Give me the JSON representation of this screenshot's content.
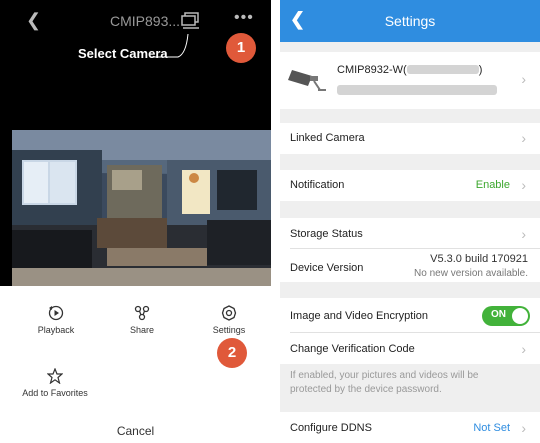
{
  "left": {
    "back_icon": "back-chevron-icon",
    "title": "CMIP893...",
    "more_icon": "more-dots-icon",
    "select_camera_label": "Select Camera",
    "annotation_1": "1",
    "annotation_2": "2",
    "actions": {
      "playback": "Playback",
      "share": "Share",
      "settings": "Settings",
      "favorites": "Add to Favorites"
    },
    "cancel": "Cancel"
  },
  "right": {
    "header": {
      "title": "Settings",
      "back_icon": "back-chevron-icon"
    },
    "device": {
      "name": "CMIP8932-W(",
      "name_suffix": ")"
    },
    "linked_camera": "Linked Camera",
    "notification": {
      "label": "Notification",
      "value": "Enable"
    },
    "storage_status": "Storage Status",
    "device_version": {
      "label": "Device Version",
      "value": "V5.3.0 build 170921",
      "status": "No new version available."
    },
    "encryption": {
      "label": "Image and Video Encryption",
      "toggle": "ON"
    },
    "change_code": "Change Verification Code",
    "encryption_note": "If enabled, your pictures and videos will be protected by the device password.",
    "ddns": {
      "label": "Configure DDNS",
      "value": "Not Set"
    }
  },
  "colors": {
    "accent": "#2f8de0",
    "enable_green": "#3ca72e",
    "toggle_green": "#42b23a",
    "badge": "#e0593a"
  }
}
